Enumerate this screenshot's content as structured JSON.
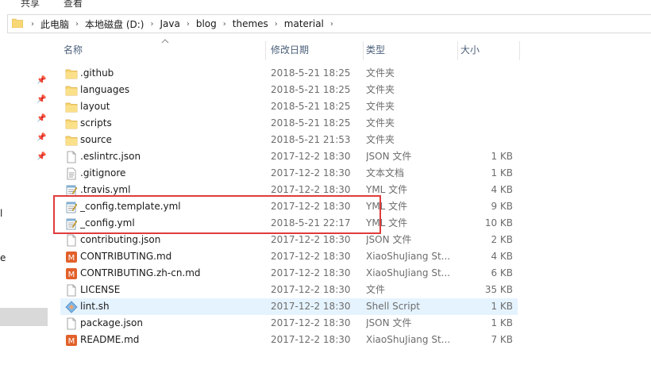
{
  "ribbon": {
    "share": "共享",
    "view": "查看"
  },
  "breadcrumb": [
    "此电脑",
    "本地磁盘 (D:)",
    "Java",
    "blog",
    "themes",
    "material"
  ],
  "left_pane": {
    "fragments": [
      "l",
      "e"
    ]
  },
  "columns": {
    "name": "名称",
    "date": "修改日期",
    "type": "类型",
    "size": "大小"
  },
  "files": [
    {
      "name": ".github",
      "date": "2018-5-21 18:25",
      "type": "文件夹",
      "size": "",
      "icon": "folder-icon"
    },
    {
      "name": "languages",
      "date": "2018-5-21 18:25",
      "type": "文件夹",
      "size": "",
      "icon": "folder-icon"
    },
    {
      "name": "layout",
      "date": "2018-5-21 18:25",
      "type": "文件夹",
      "size": "",
      "icon": "folder-icon"
    },
    {
      "name": "scripts",
      "date": "2018-5-21 18:25",
      "type": "文件夹",
      "size": "",
      "icon": "folder-icon"
    },
    {
      "name": "source",
      "date": "2018-5-21 21:53",
      "type": "文件夹",
      "size": "",
      "icon": "folder-icon"
    },
    {
      "name": ".eslintrc.json",
      "date": "2017-12-2 18:30",
      "type": "JSON 文件",
      "size": "1 KB",
      "icon": "document-icon"
    },
    {
      "name": ".gitignore",
      "date": "2017-12-2 18:30",
      "type": "文本文档",
      "size": "1 KB",
      "icon": "text-document-icon"
    },
    {
      "name": ".travis.yml",
      "date": "2017-12-2 18:30",
      "type": "YML 文件",
      "size": "4 KB",
      "icon": "notepad-icon"
    },
    {
      "name": "_config.template.yml",
      "date": "2017-12-2 18:30",
      "type": "YML 文件",
      "size": "9 KB",
      "icon": "notepad-icon"
    },
    {
      "name": "_config.yml",
      "date": "2018-5-21 22:17",
      "type": "YML 文件",
      "size": "10 KB",
      "icon": "notepad-icon"
    },
    {
      "name": "contributing.json",
      "date": "2017-12-2 18:30",
      "type": "JSON 文件",
      "size": "2 KB",
      "icon": "document-icon"
    },
    {
      "name": "CONTRIBUTING.md",
      "date": "2017-12-2 18:30",
      "type": "XiaoShuJiang St...",
      "size": "4 KB",
      "icon": "markdown-editor-icon"
    },
    {
      "name": "CONTRIBUTING.zh-cn.md",
      "date": "2017-12-2 18:30",
      "type": "XiaoShuJiang St...",
      "size": "6 KB",
      "icon": "markdown-editor-icon"
    },
    {
      "name": "LICENSE",
      "date": "2017-12-2 18:30",
      "type": "文件",
      "size": "35 KB",
      "icon": "document-icon"
    },
    {
      "name": "lint.sh",
      "date": "2017-12-2 18:30",
      "type": "Shell Script",
      "size": "1 KB",
      "icon": "git-bash-icon"
    },
    {
      "name": "package.json",
      "date": "2017-12-2 18:30",
      "type": "JSON 文件",
      "size": "1 KB",
      "icon": "document-icon"
    },
    {
      "name": "README.md",
      "date": "2017-12-2 18:30",
      "type": "XiaoShuJiang St...",
      "size": "7 KB",
      "icon": "markdown-editor-icon"
    }
  ],
  "colors": {
    "highlight_border": "#e03c3c",
    "selected_row": "#e5f3ff",
    "header_text": "#4c607a",
    "folder": "#f8d775"
  }
}
